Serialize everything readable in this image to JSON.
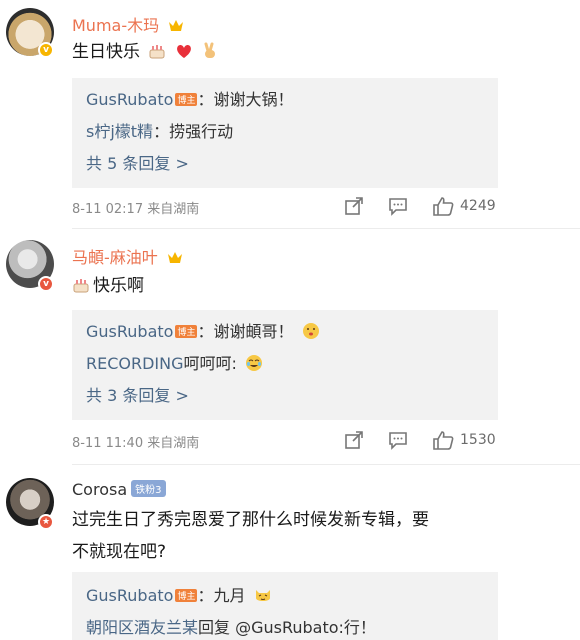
{
  "comments": [
    {
      "username": "Muma-木玛",
      "text": "生日快乐",
      "emojis": [
        "cake-emoji",
        "heart-emoji",
        "victory-hand-emoji"
      ],
      "replies": [
        {
          "name": "GusRubato",
          "host_badge": "博主",
          "text": "：谢谢大锅！"
        },
        {
          "name": "s柠j檬t精",
          "text": "：捞强行动"
        }
      ],
      "more_replies": "共 5 条回复 >",
      "timestamp": "8-11 02:17",
      "location": "来自湖南",
      "likes": "4249"
    },
    {
      "username": "马頔-麻油叶",
      "text": "快乐啊",
      "emojis": [
        "cake-emoji"
      ],
      "replies": [
        {
          "name": "GusRubato",
          "host_badge": "博主",
          "text": "：谢谢頔哥！"
        },
        {
          "name": "RECORDING",
          "text": "呵呵呵:"
        }
      ],
      "more_replies": "共 3 条回复 >",
      "timestamp": "8-11 11:40",
      "location": "来自湖南",
      "likes": "1530"
    },
    {
      "username": "Corosa",
      "fan_badge": "铁粉3",
      "text_line1": "过完生日了秀完恩爱了那什么时候发新专辑，要",
      "text_line2": "不就现在吧?",
      "replies": [
        {
          "name": "GusRubato",
          "host_badge": "博主",
          "text": "：九月"
        },
        {
          "name": "朝阳区酒友兰某",
          "text": "回复 @GusRubato:行！"
        }
      ]
    }
  ],
  "colors": {
    "username_vip": "#eb7350",
    "link_blue": "#4a6786",
    "host_orange": "#f0813a"
  }
}
